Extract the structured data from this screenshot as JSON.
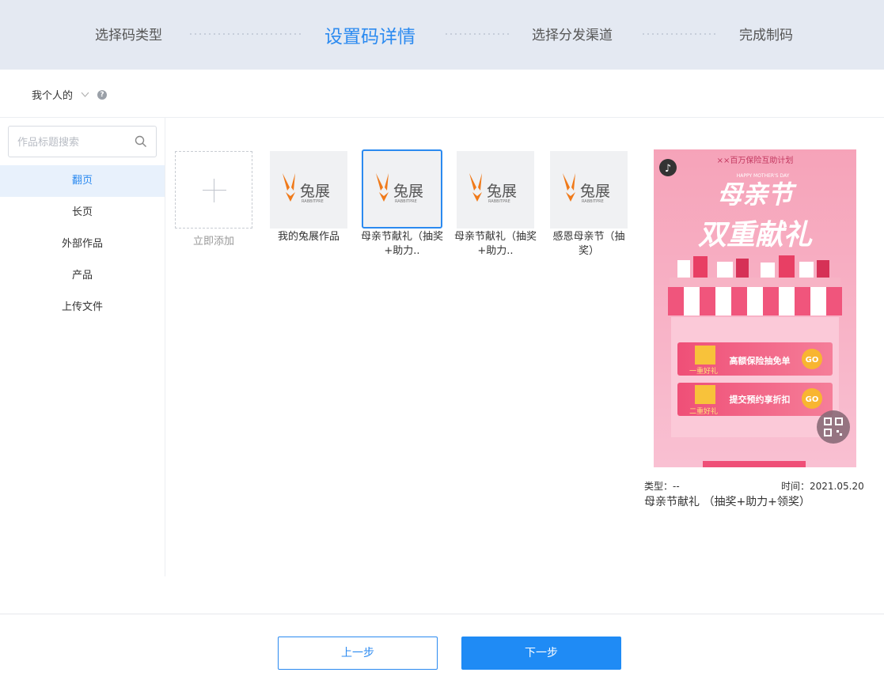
{
  "steps": [
    {
      "label": "选择码类型",
      "active": false
    },
    {
      "label": "设置码详情",
      "active": true
    },
    {
      "label": "选择分发渠道",
      "active": false
    },
    {
      "label": "完成制码",
      "active": false
    }
  ],
  "scope": {
    "label": "我个人的"
  },
  "search": {
    "placeholder": "作品标题搜索"
  },
  "sidebar": {
    "items": [
      {
        "label": "翻页",
        "active": true
      },
      {
        "label": "长页"
      },
      {
        "label": "外部作品"
      },
      {
        "label": "产品"
      },
      {
        "label": "上传文件"
      }
    ]
  },
  "grid": {
    "add_label": "立即添加",
    "items": [
      {
        "label": "我的兔展作品"
      },
      {
        "label": "母亲节献礼（抽奖+助力..",
        "selected": true
      },
      {
        "label": "母亲节献礼（抽奖+助力.."
      },
      {
        "label": "感恩母亲节（抽奖）"
      }
    ],
    "logo": {
      "text": "兔展",
      "subtext": "RABBITPRE"
    }
  },
  "preview": {
    "banner_top": "××百万保险互助计划",
    "banner_sub": "HAPPY MOTHER'S DAY",
    "headline_1": "母亲节",
    "headline_2": "双重献礼",
    "card_1": {
      "tag": "一重好礼",
      "text": "高额保险抽免单",
      "go": "GO"
    },
    "card_2": {
      "tag": "二重好礼",
      "text": "提交预约享折扣",
      "go": "GO"
    },
    "type_label": "类型：--",
    "time_label": "时间：2021.05.20",
    "title": "母亲节献礼 （抽奖+助力+领奖）"
  },
  "footer": {
    "prev": "上一步",
    "next": "下一步"
  },
  "colors": {
    "accent": "#2b8af0",
    "primary_button": "#1f8bf5",
    "logo_orange": "#f07a1a"
  }
}
